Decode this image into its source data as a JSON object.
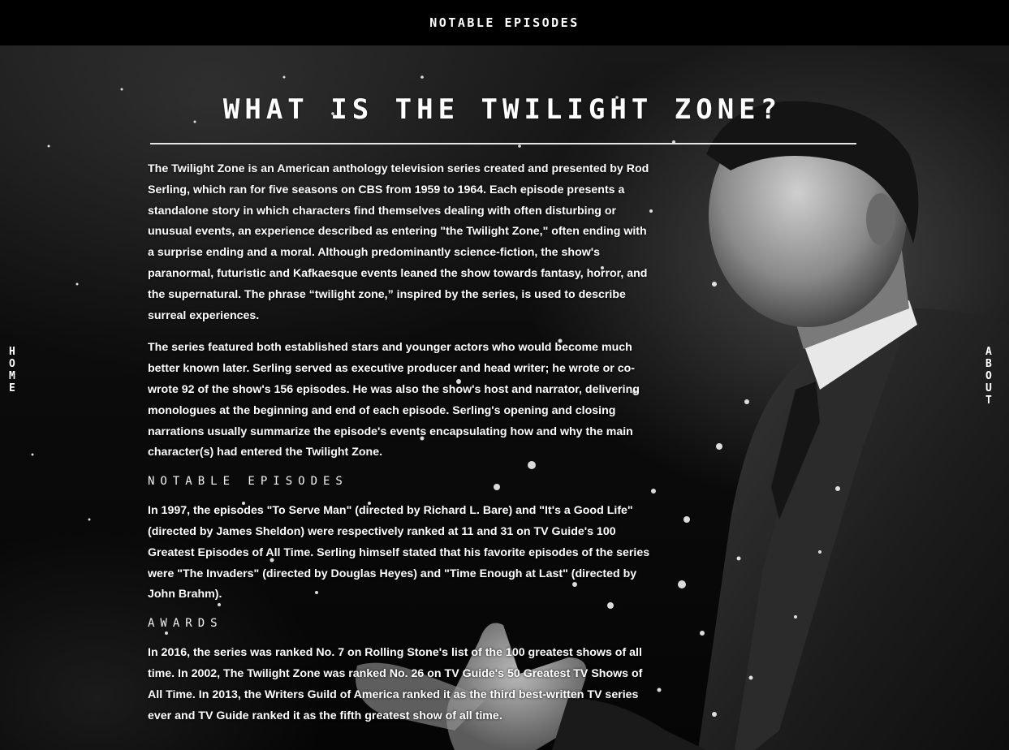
{
  "nav": {
    "top_link": "NOTABLE EPISODES",
    "left_link_letters": [
      "H",
      "O",
      "M",
      "E"
    ],
    "right_link_letters": [
      "A",
      "B",
      "O",
      "U",
      "T"
    ]
  },
  "page": {
    "title": "WHAT IS THE TWILIGHT ZONE?"
  },
  "intro": {
    "paragraph_1": "The Twilight Zone is an American anthology television series created and presented by Rod Serling, which ran for five seasons on CBS from 1959 to 1964. Each episode presents a standalone story in which characters find themselves dealing with often disturbing or unusual events, an experience described as entering \"the Twilight Zone,\" often ending with a surprise ending and a moral. Although predominantly science-fiction, the show's paranormal, futuristic and Kafkaesque events leaned the show towards fantasy, horror, and the supernatural. The phrase “twilight zone,” inspired by the series, is used to describe surreal experiences.",
    "paragraph_2": "The series featured both established stars and younger actors who would become much better known later. Serling served as executive producer and head writer; he wrote or co-wrote 92 of the show's 156 episodes. He was also the show's host and narrator, delivering monologues at the beginning and end of each episode. Serling's opening and closing narrations usually summarize the episode's events encapsulating how and why the main character(s) had entered the Twilight Zone."
  },
  "notable_episodes": {
    "heading": "NOTABLE EPISODES",
    "paragraph": "In 1997, the episodes \"To Serve Man\" (directed by Richard L. Bare) and \"It's a Good Life\" (directed by James Sheldon) were respectively ranked at 11 and 31 on TV Guide's 100 Greatest Episodes of All Time. Serling himself stated that his favorite episodes of the series were \"The Invaders\" (directed by Douglas Heyes) and \"Time Enough at Last\" (directed by John Brahm)."
  },
  "awards": {
    "heading": "AWARDS",
    "paragraph": "In 2016, the series was ranked No. 7 on Rolling Stone's list of the 100 greatest shows of all time. In 2002, The Twilight Zone was ranked No. 26 on TV Guide's 50 Greatest TV Shows of All Time. In 2013, the Writers Guild of America ranked it as the third best-written TV series ever and TV Guide ranked it as the fifth greatest show of all time."
  }
}
